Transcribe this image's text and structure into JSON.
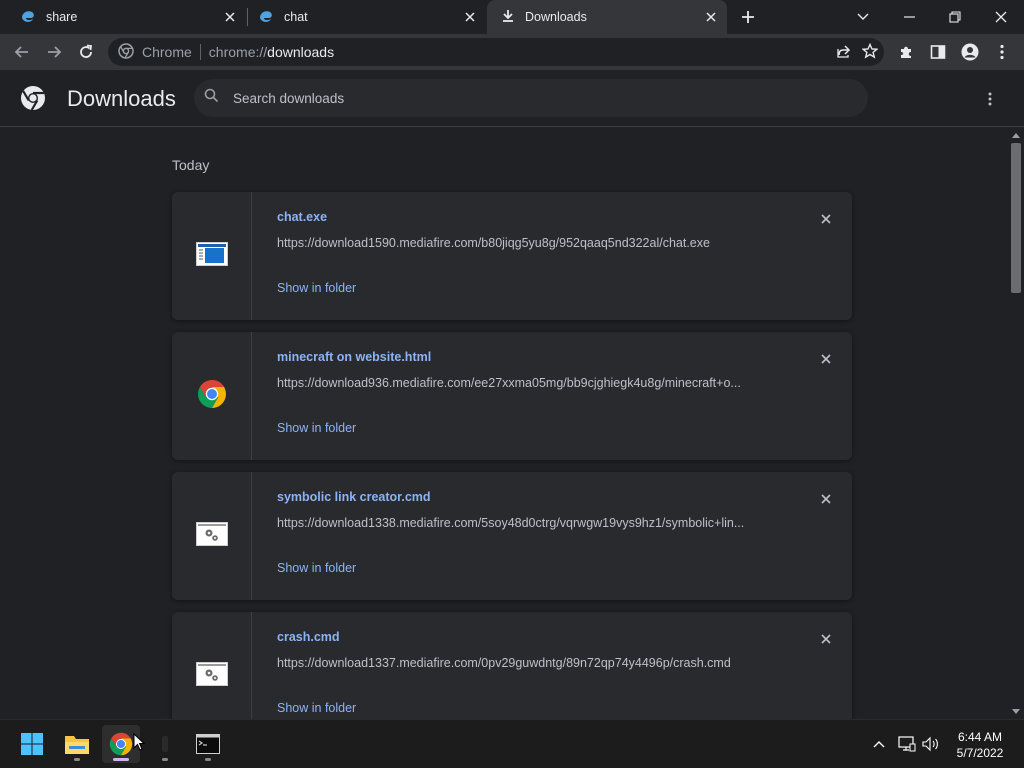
{
  "tabs": [
    {
      "title": "share",
      "icon": "edge-swirl-icon"
    },
    {
      "title": "chat",
      "icon": "edge-swirl-icon"
    },
    {
      "title": "Downloads",
      "icon": "download-icon",
      "active": true
    }
  ],
  "omnibox": {
    "site_label": "Chrome",
    "url_scheme": "chrome://",
    "url_host": "downloads"
  },
  "downloads_page": {
    "title": "Downloads",
    "search_placeholder": "Search downloads",
    "section_label": "Today",
    "items": [
      {
        "name": "chat.exe",
        "url": "https://download1590.mediafire.com/b80jiqg5yu8g/952qaaq5nd322al/chat.exe",
        "action": "Show in folder",
        "icon": "exe-window-icon"
      },
      {
        "name": "minecraft on website.html",
        "url": "https://download936.mediafire.com/ee27xxma05mg/bb9cjghiegk4u8g/minecraft+o...",
        "action": "Show in folder",
        "icon": "chrome-icon"
      },
      {
        "name": "symbolic link creator.cmd",
        "url": "https://download1338.mediafire.com/5soy48d0ctrg/vqrwgw19vys9hz1/symbolic+lin...",
        "action": "Show in folder",
        "icon": "cmd-gears-icon"
      },
      {
        "name": "crash.cmd",
        "url": "https://download1337.mediafire.com/0pv29guwdntg/89n72qp74y4496p/crash.cmd",
        "action": "Show in folder",
        "icon": "cmd-gears-icon"
      }
    ]
  },
  "taskbar": {
    "time": "6:44 AM",
    "date": "5/7/2022"
  },
  "colors": {
    "accent": "#8ab4f8",
    "background": "#202124",
    "card": "#292a2d",
    "toolbar": "#35363a"
  }
}
